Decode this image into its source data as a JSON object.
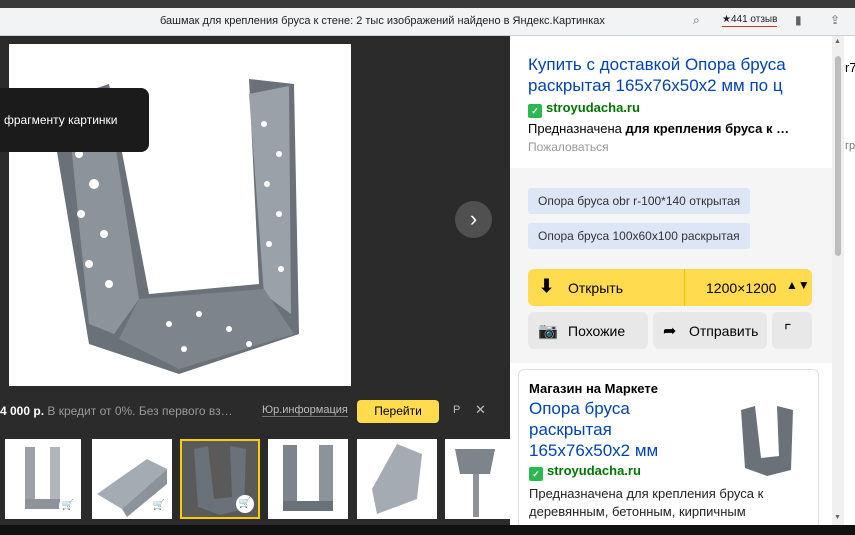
{
  "browser": {
    "tab_title": "башмак для крепления бруса к стене: 2 тыс изображений найдено в Яндекс.Картинках",
    "rating": "★441 отзыв"
  },
  "viewer": {
    "tooltip": "фрагменту картинки",
    "ad": {
      "price": "4 000 р.",
      "credit": "В кредит от 0%. Без первого вз…",
      "legal": "Юр.информация",
      "go_button": "Перейти",
      "ad_marker": "Р"
    },
    "thumbnail_count": 6
  },
  "panel": {
    "result": {
      "title": "Купить с доставкой Опора бруса раскрытая 165х76х50х2 мм по ц",
      "site": "stroyudacha.ru",
      "desc_prefix": "Предназначена ",
      "desc_bold": "для крепления бруса к …",
      "complain": "Пожаловаться"
    },
    "chips": [
      "Опора бруса obr r-100*140 открытая",
      "Опора бруса 100х60х100 раскрытая"
    ],
    "open_button": "Открыть",
    "size": "1200×1200",
    "similar_button": "Похожие",
    "share_button": "Отправить",
    "market": {
      "header": "Магазин на Маркете",
      "title": "Опора бруса раскрытая 165х76х50х2 мм",
      "site": "stroyudacha.ru",
      "desc": "Предназначена для крепления бруса к деревянным, бетонным, кирпичным основаниям Изготовлена из оцинкованно"
    },
    "edge_text": "r7",
    "edge_text2": "гр"
  }
}
